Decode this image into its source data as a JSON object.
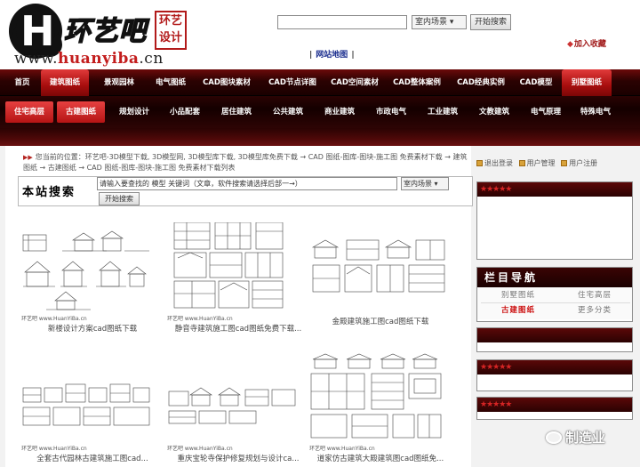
{
  "header": {
    "logo_url_prefix": "www.",
    "logo_url_brand": "huanyiba",
    "logo_url_suffix": ".cn",
    "logo_text": "环艺吧",
    "logo_seal": "环艺\n设计",
    "search_placeholder": "",
    "search_select": "室内场景",
    "search_button": "开始搜索",
    "sitemap": "网站地图",
    "favorite": "加入收藏"
  },
  "nav1": [
    "首页",
    "建筑图纸",
    "景观园林",
    "电气图纸",
    "CAD图块素材",
    "CAD节点详图",
    "CAD空间素材",
    "CAD整体案例",
    "CAD经典实例",
    "CAD模型",
    "别墅图纸"
  ],
  "nav2": [
    "住宅高层",
    "古建图纸",
    "规划设计",
    "小品配套",
    "居住建筑",
    "公共建筑",
    "商业建筑",
    "市政电气",
    "工业建筑",
    "文教建筑",
    "电气原理",
    "特殊电气"
  ],
  "breadcrumb": {
    "lead": "您当前的位置：",
    "path": "环艺吧-3D模型下载, 3D模型网, 3D模型库下载, 3D模型库免费下载 → CAD 图纸-图库-图块-施工图 免费素材下载 → 建筑图纸 → 古建图纸 → CAD 图纸-图库-图块-施工图 免费素材下载列表"
  },
  "site_search": {
    "title": "本站搜索",
    "input_value": "请输入要查找的 模型 关键词（文章，软件搜索请选择后部一→）",
    "select_value": "室内场景",
    "button": "开始搜索"
  },
  "items": [
    {
      "watermark": "环艺吧 www.HuanYiBa.cn",
      "caption": "新楼设计方案cad图纸下载"
    },
    {
      "watermark": "环艺吧 www.HuanYiBa.cn",
      "caption": "静音寺建筑施工图cad图纸免费下载..."
    },
    {
      "watermark": "",
      "caption": "金殿建筑施工图cad图纸下载"
    },
    {
      "watermark": "环艺吧 www.HuanYiBa.cn",
      "caption": "全套古代园林古建筑施工图cad..."
    },
    {
      "watermark": "环艺吧 www.HuanYiBa.cn",
      "caption": "重庆宝轮寺保护修复规划与设计ca..."
    },
    {
      "watermark": "环艺吧 www.HuanYiBa.cn",
      "caption": "道家仿古建筑大殿建筑图cad图纸免..."
    }
  ],
  "sidebar": {
    "user_links": [
      "退出登录",
      "用户管理",
      "用户注册"
    ],
    "stars_1": "★★★★★",
    "nav_title": "栏目导航",
    "nav_items": [
      "别墅图纸",
      "住宅高层",
      "古建图纸",
      "更多分类"
    ],
    "stars_2": "★★★★★",
    "stars_3": "★★★★★"
  },
  "wechat_label": "制造业",
  "colors": {
    "brand_dark": "#2b0202",
    "brand_active": "#b51414",
    "accent_red": "#c11111"
  }
}
